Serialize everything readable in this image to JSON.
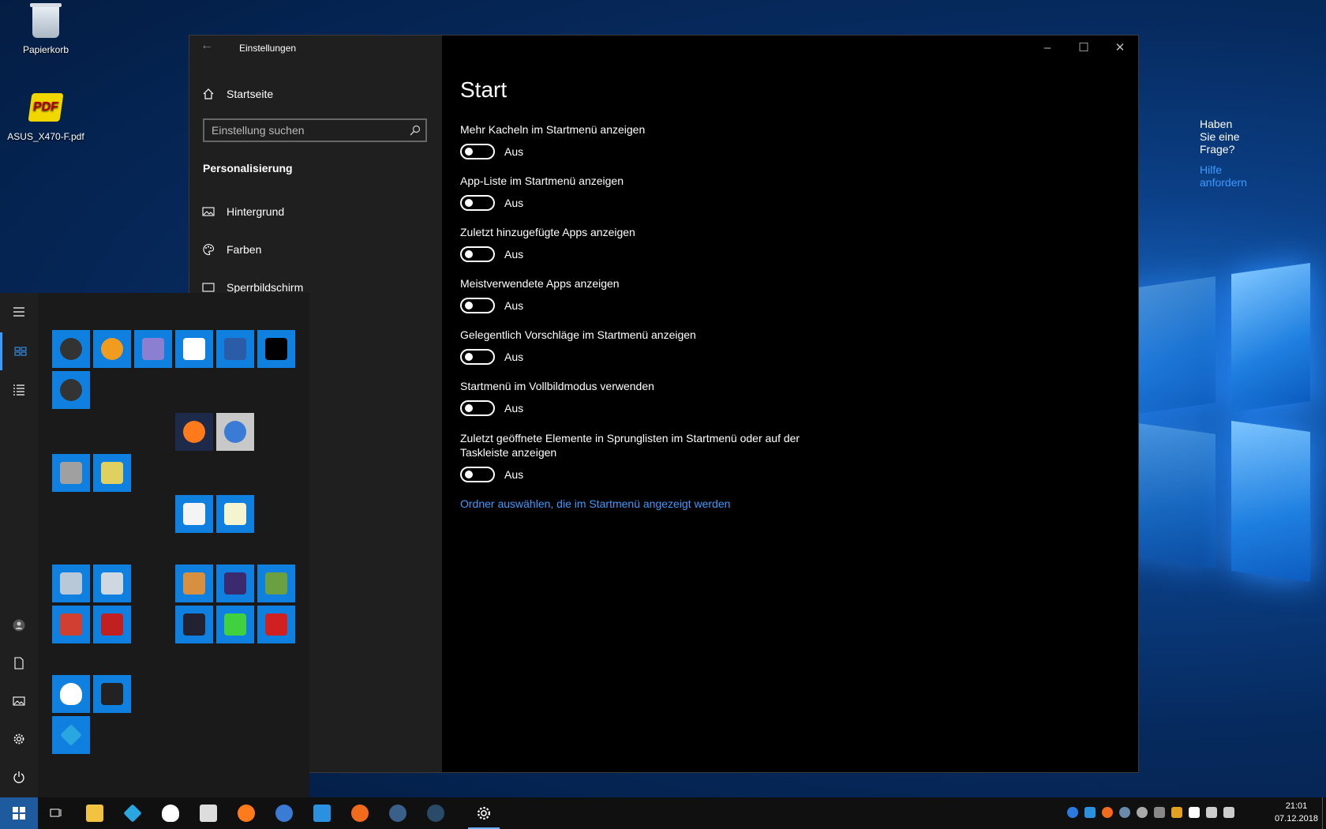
{
  "desktop": {
    "icons": [
      {
        "label": "Papierkorb",
        "icon": "recycle-bin-icon"
      },
      {
        "label": "ASUS_X470-F.pdf",
        "icon": "pdf-file-icon"
      }
    ]
  },
  "settings": {
    "window_title": "Einstellungen",
    "home": "Startseite",
    "search_placeholder": "Einstellung suchen",
    "section": "Personalisierung",
    "nav": [
      "Hintergrund",
      "Farben",
      "Sperrbildschirm"
    ],
    "page_title": "Start",
    "options": [
      {
        "label": "Mehr Kacheln im Startmenü anzeigen",
        "state": "Aus"
      },
      {
        "label": "App-Liste im Startmenü anzeigen",
        "state": "Aus"
      },
      {
        "label": "Zuletzt hinzugefügte Apps anzeigen",
        "state": "Aus"
      },
      {
        "label": "Meistverwendete Apps anzeigen",
        "state": "Aus"
      },
      {
        "label": "Gelegentlich Vorschläge im Startmenü anzeigen",
        "state": "Aus"
      },
      {
        "label": "Startmenü im Vollbildmodus verwenden",
        "state": "Aus"
      },
      {
        "label": "Zuletzt geöffnete Elemente in Sprunglisten im Startmenü oder auf der Taskleiste anzeigen",
        "state": "Aus"
      }
    ],
    "folders_link": "Ordner auswählen, die im Startmenü angezeigt werden",
    "help_question": "Haben Sie eine Frage?",
    "help_link": "Hilfe anfordern"
  },
  "start_menu": {
    "rail": [
      "menu-icon",
      "tiles-icon",
      "all-apps-icon",
      "user-icon",
      "documents-icon",
      "pictures-icon",
      "settings-icon",
      "power-icon"
    ],
    "tiles": [
      {
        "name": "headset-app-tile",
        "color": "#1080e0"
      },
      {
        "name": "x-app-tile",
        "color": "#1080e0"
      },
      {
        "name": "ghost-app-tile",
        "color": "#1080e0"
      },
      {
        "name": "7zip-tile",
        "color": "#1080e0"
      },
      {
        "name": "powershell-tile",
        "color": "#1080e0"
      },
      {
        "name": "cmd-tile",
        "color": "#1080e0"
      },
      {
        "name": "headset-app-2-tile",
        "color": "#1080e0"
      },
      {
        "name": "firefox-tile",
        "color": "#1e2a4a"
      },
      {
        "name": "thunderbird-tile",
        "color": "#c8c8c8"
      },
      {
        "name": "lock-app-tile",
        "color": "#1080e0"
      },
      {
        "name": "network-app-tile",
        "color": "#1080e0"
      },
      {
        "name": "writer-tile",
        "color": "#1080e0"
      },
      {
        "name": "notepad-tile",
        "color": "#1080e0"
      },
      {
        "name": "folder-app-tile",
        "color": "#1080e0"
      },
      {
        "name": "tools-app-tile",
        "color": "#1080e0"
      },
      {
        "name": "paint-app-tile",
        "color": "#1080e0"
      },
      {
        "name": "cpu-app-tile",
        "color": "#1080e0"
      },
      {
        "name": "gpu-app-tile",
        "color": "#1080e0"
      },
      {
        "name": "cleaner-app-tile",
        "color": "#1080e0"
      },
      {
        "name": "filezilla-tile",
        "color": "#1080e0"
      },
      {
        "name": "bar-app-tile",
        "color": "#1080e0"
      },
      {
        "name": "2048-app-tile",
        "color": "#1080e0"
      },
      {
        "name": "flash-app-tile",
        "color": "#1080e0"
      },
      {
        "name": "alien-app-tile",
        "color": "#1080e0"
      },
      {
        "name": "clapper-app-tile",
        "color": "#1080e0"
      },
      {
        "name": "kodi-tile",
        "color": "#1080e0"
      }
    ]
  },
  "taskbar": {
    "apps": [
      "start-button",
      "task-view-icon",
      "file-explorer-icon",
      "kodi-icon",
      "alien-icon",
      "clapper-icon",
      "firefox-icon",
      "thunderbird-icon",
      "network-tool-icon",
      "origin-icon",
      "steam-icon",
      "headset-icon",
      "settings-icon"
    ],
    "time": "21:01",
    "date": "07.12.2018"
  },
  "colors": {
    "accent": "#3a9bff",
    "tile": "#1080e0",
    "sidebar": "#1f1f1f"
  }
}
